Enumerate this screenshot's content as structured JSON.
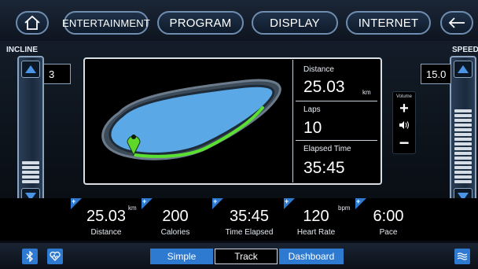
{
  "nav": {
    "home_icon": "home-icon",
    "entertainment": "ENTERTAINMENT",
    "program": "PROGRAM",
    "display": "DISPLAY",
    "internet": "INTERNET",
    "back_icon": "arrow-left-icon"
  },
  "incline": {
    "label": "INCLINE",
    "value": "3",
    "level_fraction": 0.25
  },
  "speed": {
    "label": "SPEED",
    "value": "15.0",
    "level_fraction": 0.8
  },
  "track": {
    "distance_label": "Distance",
    "distance_value": "25.03",
    "distance_unit": "km",
    "laps_label": "Laps",
    "laps_value": "10",
    "elapsed_label": "Elapsed Time",
    "elapsed_value": "35:45"
  },
  "volume": {
    "label": "Volume",
    "plus": "+",
    "minus": "−"
  },
  "metrics": [
    {
      "value": "25.03",
      "unit": "km",
      "label": "Distance"
    },
    {
      "value": "200",
      "unit": "",
      "label": "Calories"
    },
    {
      "value": "35:45",
      "unit": "",
      "label": "Time Elapsed"
    },
    {
      "value": "120",
      "unit": "bpm",
      "label": "Heart Rate"
    },
    {
      "value": "6:00",
      "unit": "",
      "label": "Pace"
    }
  ],
  "metric_plus": "+",
  "tabs": {
    "simple": "Simple",
    "track": "Track",
    "dashboard": "Dashboard"
  },
  "colors": {
    "accent": "#2f7ad1",
    "track_fill": "#5aa8e6",
    "progress": "#59e030",
    "marker": "#5ed62a"
  }
}
